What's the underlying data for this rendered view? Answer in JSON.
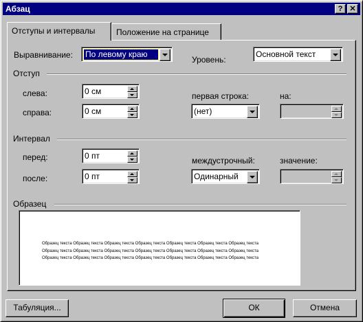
{
  "window": {
    "title": "Абзац",
    "help_button": "?",
    "close_button": "✕"
  },
  "tabs": [
    {
      "label": "Отступы и интервалы"
    },
    {
      "label": "Положение на странице"
    }
  ],
  "alignment": {
    "label": "Выравнивание:",
    "value": "По левому краю"
  },
  "level": {
    "label": "Уровень:",
    "value": "Основной текст"
  },
  "indent": {
    "group_label": "Отступ",
    "left_label": "слева:",
    "left_value": "0 см",
    "right_label": "справа:",
    "right_value": "0 см",
    "first_line_label": "первая строка:",
    "first_line_value": "(нет)",
    "by_label": "на:",
    "by_value": ""
  },
  "spacing": {
    "group_label": "Интервал",
    "before_label": "перед:",
    "before_value": "0 пт",
    "after_label": "после:",
    "after_value": "0 пт",
    "line_spacing_label": "междустрочный:",
    "line_spacing_value": "Одинарный",
    "at_label": "значение:",
    "at_value": ""
  },
  "preview": {
    "group_label": "Образец",
    "sample_text": "Образец текста Образец текста Образец текста Образец текста Образец текста Образец текста Образец текста Образец текста Образец текста Образец текста Образец текста Образец текста Образец текста Образец текста Образец текста Образец текста Образец текста Образец текста Образец текста Образец текста Образец текста"
  },
  "buttons": {
    "tabs_label": "Табуляция...",
    "ok_label": "ОК",
    "cancel_label": "Отмена"
  },
  "colors": {
    "titlebar": "#000080",
    "face": "#c0c0c0",
    "selection": "#000080"
  }
}
